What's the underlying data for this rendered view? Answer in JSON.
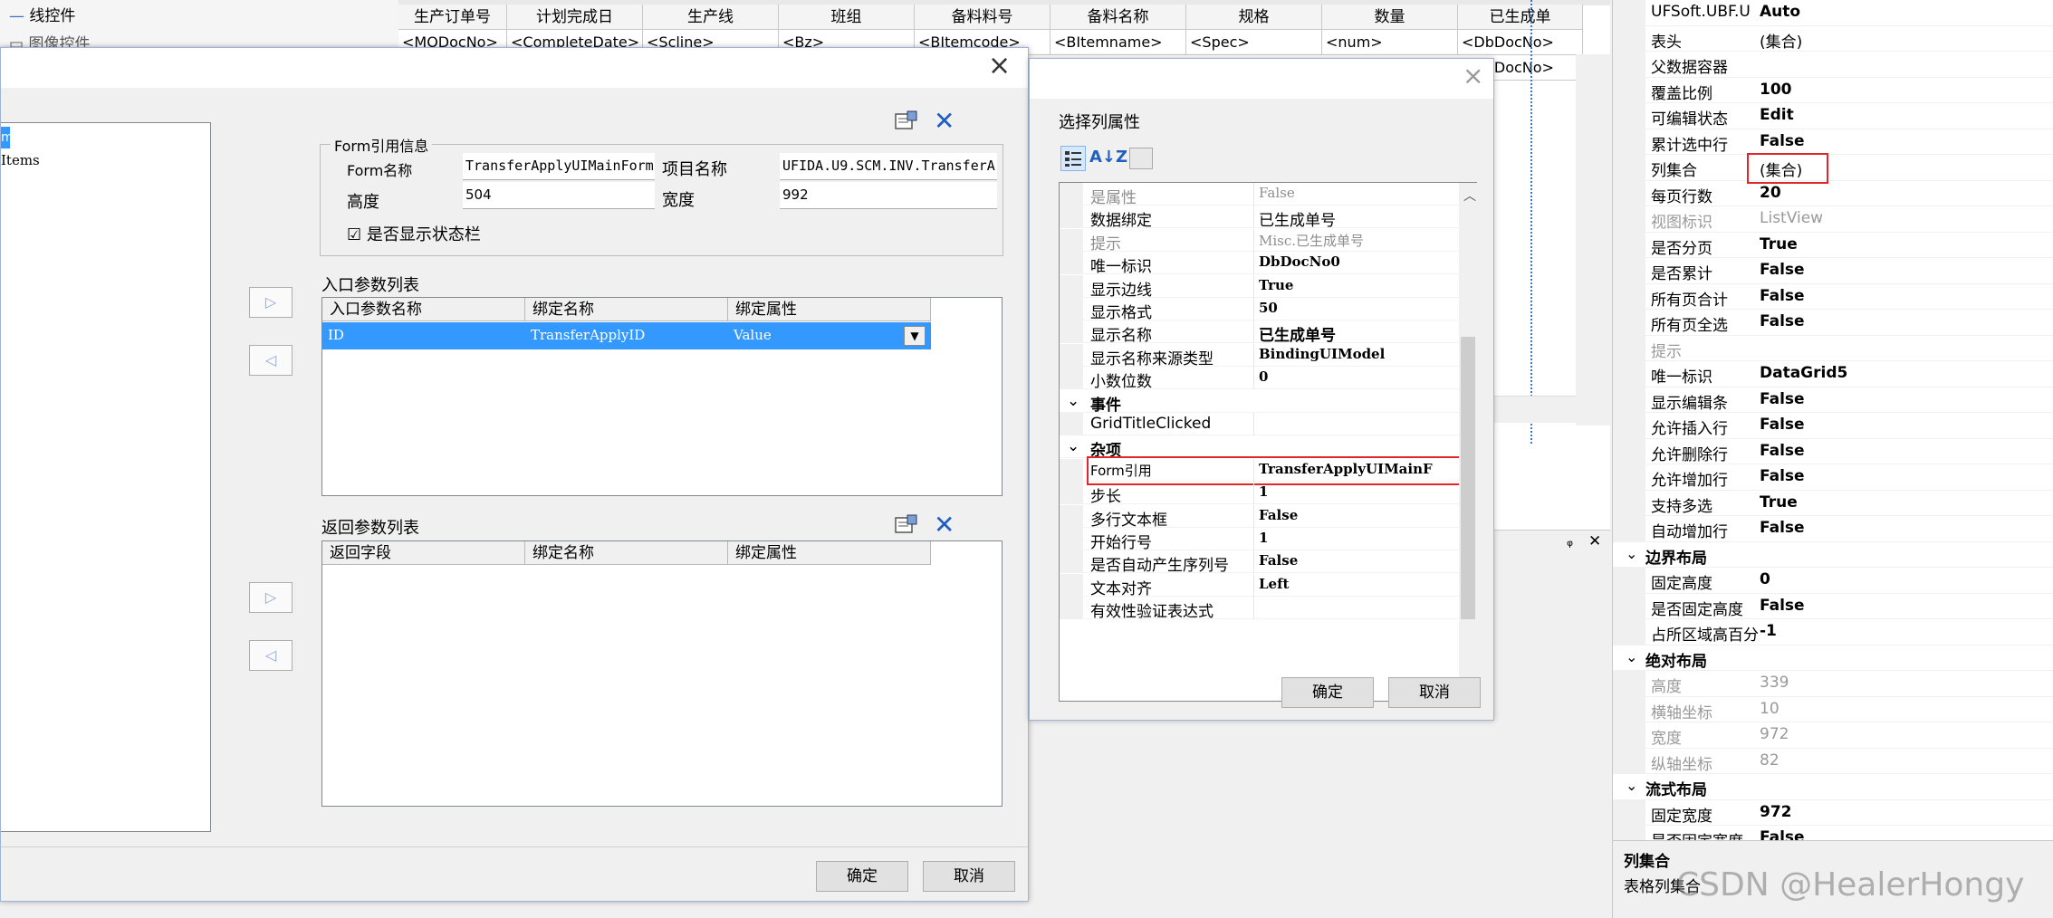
{
  "background": {
    "tree": {
      "item1": "线控件",
      "item2": "图像控件"
    },
    "grid": {
      "headers": [
        "生产订单号",
        "计划完成日",
        "生产线",
        "班组",
        "备料料号",
        "备料名称",
        "规格",
        "数量",
        "已生成单"
      ],
      "cells": [
        "<MODocNo>",
        "<CompleteDate>",
        "<Scline>",
        "<Bz>",
        "<BItemcode>",
        "<BItemname>",
        "<Spec>",
        "<num>",
        "<DbDocNo>"
      ],
      "cell_row2_last": "<DbDocNo>"
    },
    "bottom_strip": {
      "pin": "ᵩ",
      "close": "✕"
    }
  },
  "property_panel": {
    "rows": [
      {
        "name": "UFSoft.UBF.U",
        "value": "Auto",
        "type": "prop"
      },
      {
        "name": "表头",
        "value": "(集合)",
        "type": "prop",
        "plain": true
      },
      {
        "name": "父数据容器",
        "value": "",
        "type": "prop"
      },
      {
        "name": "覆盖比例",
        "value": "100",
        "type": "prop"
      },
      {
        "name": "可编辑状态",
        "value": "Edit",
        "type": "prop"
      },
      {
        "name": "累计选中行",
        "value": "False",
        "type": "prop"
      },
      {
        "name": "列集合",
        "value": "(集合)",
        "type": "prop",
        "plain": true,
        "highlight": true
      },
      {
        "name": "每页行数",
        "value": "20",
        "type": "prop"
      },
      {
        "name": "视图标识",
        "value": "ListView",
        "type": "dim"
      },
      {
        "name": "是否分页",
        "value": "True",
        "type": "prop"
      },
      {
        "name": "是否累计",
        "value": "False",
        "type": "prop"
      },
      {
        "name": "所有页合计",
        "value": "False",
        "type": "prop"
      },
      {
        "name": "所有页全选",
        "value": "False",
        "type": "prop"
      },
      {
        "name": "提示",
        "value": "",
        "type": "dim"
      },
      {
        "name": "唯一标识",
        "value": "DataGrid5",
        "type": "prop"
      },
      {
        "name": "显示编辑条",
        "value": "False",
        "type": "prop"
      },
      {
        "name": "允许插入行",
        "value": "False",
        "type": "prop"
      },
      {
        "name": "允许删除行",
        "value": "False",
        "type": "prop"
      },
      {
        "name": "允许增加行",
        "value": "False",
        "type": "prop"
      },
      {
        "name": "支持多选",
        "value": "True",
        "type": "prop"
      },
      {
        "name": "自动增加行",
        "value": "False",
        "type": "prop"
      },
      {
        "name": "边界布局",
        "value": "",
        "type": "cat"
      },
      {
        "name": "固定高度",
        "value": "0",
        "type": "prop"
      },
      {
        "name": "是否固定高度",
        "value": "False",
        "type": "prop"
      },
      {
        "name": "占所区域高百分",
        "value": "-1",
        "type": "prop"
      },
      {
        "name": "绝对布局",
        "value": "",
        "type": "cat"
      },
      {
        "name": "高度",
        "value": "339",
        "type": "dim"
      },
      {
        "name": "横轴坐标",
        "value": "10",
        "type": "dim"
      },
      {
        "name": "宽度",
        "value": "972",
        "type": "dim"
      },
      {
        "name": "纵轴坐标",
        "value": "82",
        "type": "dim"
      },
      {
        "name": "流式布局",
        "value": "",
        "type": "cat"
      },
      {
        "name": "固定宽度",
        "value": "972",
        "type": "prop"
      },
      {
        "name": "是否固定宽度",
        "value": "False",
        "type": "prop"
      }
    ],
    "desc_title": "列集合",
    "desc_text": "表格列集合",
    "watermark": "CSDN @HealerHongy"
  },
  "dialog1": {
    "close": "×",
    "tree": {
      "selected": "m",
      "item2": "Items"
    },
    "form_ref": {
      "group_title": "Form引用信息",
      "form_name_label": "Form名称",
      "form_name_value": "TransferApplyUIMainForm",
      "project_name_label": "项目名称",
      "project_name_value": "UFIDA.U9.SCM.INV.TransferA",
      "height_label": "高度",
      "height_value": "504",
      "width_label": "宽度",
      "width_value": "992",
      "statusbar_check": "☑",
      "statusbar_label": "是否显示状态栏"
    },
    "entry_params": {
      "title": "入口参数列表",
      "headers": [
        "入口参数名称",
        "绑定名称",
        "绑定属性"
      ],
      "row": {
        "name": "ID",
        "binding": "TransferApplyID",
        "attr": "Value"
      }
    },
    "return_params": {
      "title": "返回参数列表",
      "headers": [
        "返回字段",
        "绑定名称",
        "绑定属性"
      ]
    },
    "arrows": {
      "right": "▷",
      "left": "◁"
    },
    "ok": "确定",
    "cancel": "取消"
  },
  "dialog2": {
    "close": "×",
    "title": "选择列属性",
    "rows": [
      {
        "name": "是属性",
        "value": "False",
        "type": "dim"
      },
      {
        "name": "数据绑定",
        "value": "已生成单号",
        "type": "prop",
        "plain": true
      },
      {
        "name": "提示",
        "value": "Misc.已生成单号",
        "type": "dim"
      },
      {
        "name": "唯一标识",
        "value": "DbDocNo0",
        "type": "prop"
      },
      {
        "name": "显示边线",
        "value": "True",
        "type": "prop"
      },
      {
        "name": "显示格式",
        "value": "50",
        "type": "prop"
      },
      {
        "name": "显示名称",
        "value": "已生成单号",
        "type": "prop"
      },
      {
        "name": "显示名称来源类型",
        "value": "BindingUIModel",
        "type": "prop"
      },
      {
        "name": "小数位数",
        "value": "0",
        "type": "prop"
      },
      {
        "name": "事件",
        "value": "",
        "type": "cat"
      },
      {
        "name": "GridTitleClicked",
        "value": "",
        "type": "prop"
      },
      {
        "name": "杂项",
        "value": "",
        "type": "cat"
      },
      {
        "name": "Form引用",
        "value": "TransferApplyUIMainF",
        "type": "prop",
        "highlight": true
      },
      {
        "name": "步长",
        "value": "1",
        "type": "prop"
      },
      {
        "name": "多行文本框",
        "value": "False",
        "type": "prop"
      },
      {
        "name": "开始行号",
        "value": "1",
        "type": "prop"
      },
      {
        "name": "是否自动产生序列号",
        "value": "False",
        "type": "prop"
      },
      {
        "name": "文本对齐",
        "value": "Left",
        "type": "prop"
      },
      {
        "name": "有效性验证表达式",
        "value": "",
        "type": "prop"
      }
    ],
    "ok": "确定",
    "cancel": "取消"
  },
  "colors": {
    "accent": "#3399ff",
    "highlight": "#e0262b",
    "icon_blue": "#1f5fbf"
  }
}
